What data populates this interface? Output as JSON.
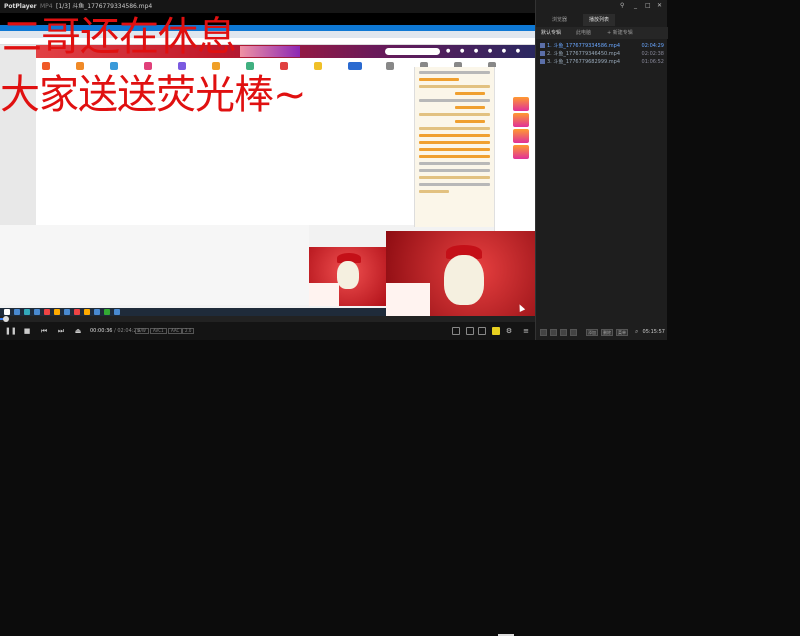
{
  "app": {
    "logo": "PotPlayer",
    "tab_mini": "MP4",
    "file_title": "[1/3] 斗鱼_1776779334586.mp4"
  },
  "overlay": {
    "line1": "二哥还在休息",
    "line2": "大家送送荧光棒~"
  },
  "player": {
    "time_current": "00:00:36",
    "time_total": "/ 02:04:29",
    "chips": [
      "S/W",
      "AVC1",
      "AAC",
      "2.0"
    ],
    "progress": 0.005,
    "volume": 1.0
  },
  "panel": {
    "tabs": [
      "浏览器",
      "播放列表"
    ],
    "active_tab": 1,
    "subtabs": [
      "默认专辑",
      "此电脑",
      "+ 新建专辑"
    ],
    "active_subtab": 0,
    "playlist": [
      {
        "name": "1. 斗鱼_1776779334586.mp4",
        "duration": "02:04:29",
        "active": true
      },
      {
        "name": "2. 斗鱼_1776779346450.mp4",
        "duration": "02:02:38",
        "active": false
      },
      {
        "name": "3. 斗鱼_1776779682999.mp4",
        "duration": "01:06:52",
        "active": false
      }
    ],
    "bottom_buttons": [
      "添加",
      "删除",
      "菜单"
    ],
    "clock": "05:15:57"
  },
  "colors": {
    "accent": "#3b82f6",
    "overlay_text": "#e01010",
    "background": "#0c0c0c"
  }
}
